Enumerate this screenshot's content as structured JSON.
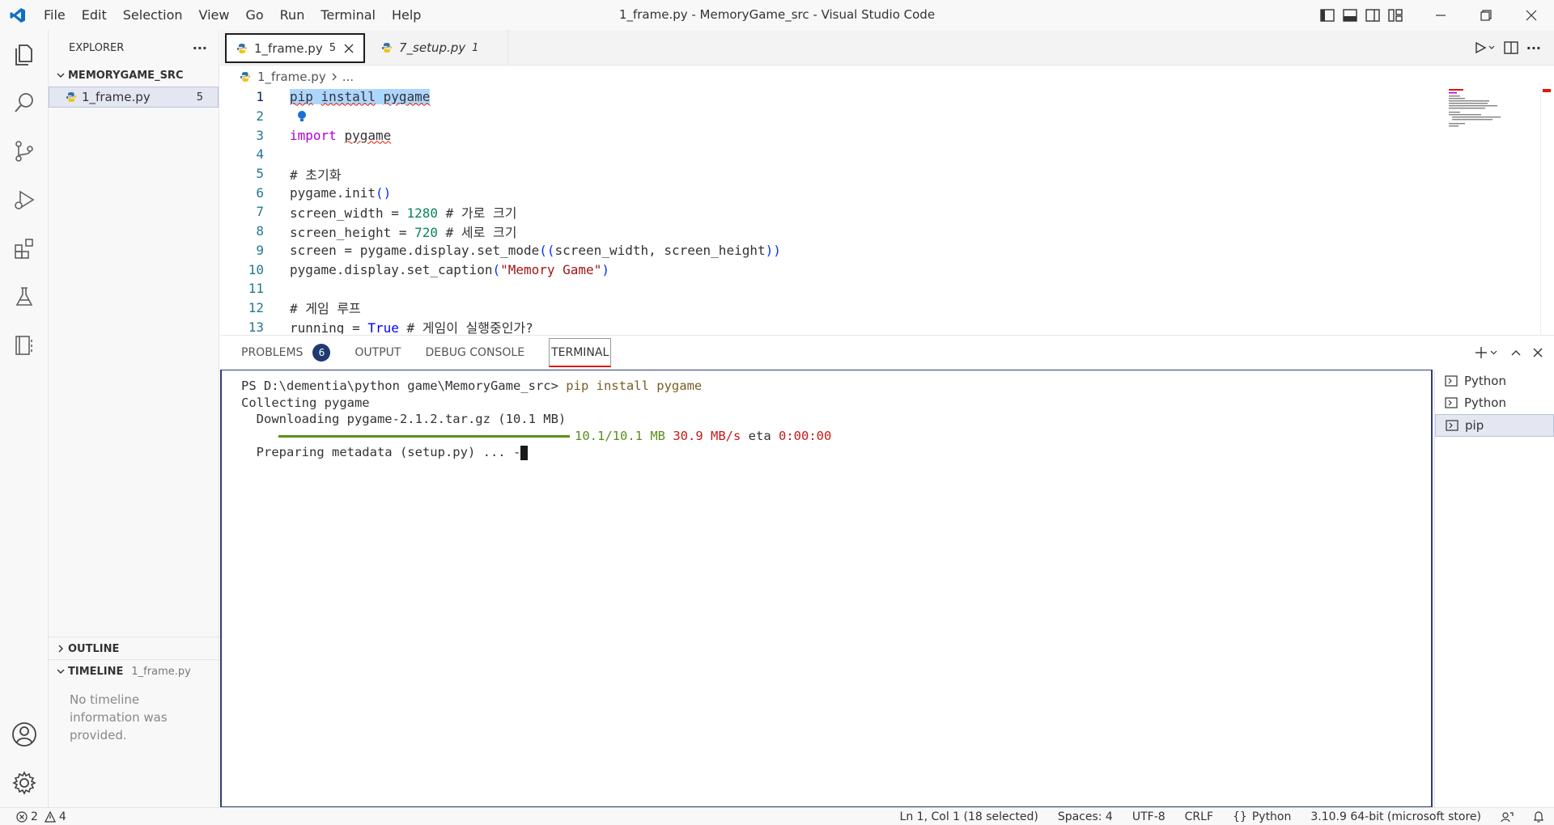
{
  "window": {
    "title": "1_frame.py - MemoryGame_src - Visual Studio Code",
    "menu": [
      "File",
      "Edit",
      "Selection",
      "View",
      "Go",
      "Run",
      "Terminal",
      "Help"
    ]
  },
  "sidebar": {
    "header": "EXPLORER",
    "more": "···",
    "folder": "MEMORYGAME_SRC",
    "file": {
      "name": "1_frame.py",
      "count": "5"
    },
    "outline": "OUTLINE",
    "timeline": {
      "title": "TIMELINE",
      "file": "1_frame.py",
      "message": "No timeline information was provided."
    }
  },
  "tabs": [
    {
      "name": "1_frame.py",
      "badge": "5"
    },
    {
      "name": "7_setup.py",
      "badge": "1"
    }
  ],
  "breadcrumb": {
    "file": "1_frame.py",
    "more": "..."
  },
  "code": {
    "line_numbers": [
      "1",
      "2",
      "3",
      "4",
      "5",
      "6",
      "7",
      "8",
      "9",
      "10",
      "11",
      "12",
      "13"
    ],
    "l1": {
      "w1": "pip",
      "w2": "install",
      "w3": "pygame"
    },
    "l3": {
      "kw": "import",
      "mod": "pygame"
    },
    "l5": "# 초기화",
    "l6": {
      "a": "pygame.init",
      "b": "()"
    },
    "l7": {
      "a": "screen_width = ",
      "num": "1280",
      "com": " # 가로 크기"
    },
    "l8": {
      "a": "screen_height = ",
      "num": "720",
      "com": " # 세로 크기"
    },
    "l9": {
      "a": "screen = pygame.display.set_mode",
      "b": "((",
      "c": "screen_width, screen_height",
      "d": "))"
    },
    "l10": {
      "a": "pygame.display.set_caption",
      "b": "(",
      "str": "\"Memory Game\"",
      "d": ")"
    },
    "l12": "# 게임 루프",
    "l13": {
      "a": "running = ",
      "val": "True",
      "com": " # 게임이 실행중인가?"
    }
  },
  "panel": {
    "tabs": {
      "problems": "PROBLEMS",
      "problems_count": "6",
      "output": "OUTPUT",
      "debug": "DEBUG CONSOLE",
      "terminal": "TERMINAL"
    },
    "terminal": {
      "prompt": "PS D:\\dementia\\python game\\MemoryGame_src> ",
      "command": "pip install pygame",
      "line2": "Collecting pygame",
      "line3": "  Downloading pygame-2.1.2.tar.gz (10.1 MB)",
      "progress_size": "10.1/10.1 MB",
      "progress_speed": "30.9 MB/s",
      "progress_eta_label": "eta",
      "progress_eta": "0:00:00",
      "line5": "  Preparing metadata (setup.py) ... -"
    },
    "terminals": [
      "Python",
      "Python",
      "pip"
    ]
  },
  "status": {
    "errors": "2",
    "warnings": "4",
    "position": "Ln 1, Col 1 (18 selected)",
    "spaces": "Spaces: 4",
    "encoding": "UTF-8",
    "eol": "CRLF",
    "language": "Python",
    "interpreter": "3.10.9 64-bit (microsoft store)"
  },
  "colors": {
    "accent": "#0078d4",
    "badge": "#1f3a70",
    "error": "#e51400"
  }
}
